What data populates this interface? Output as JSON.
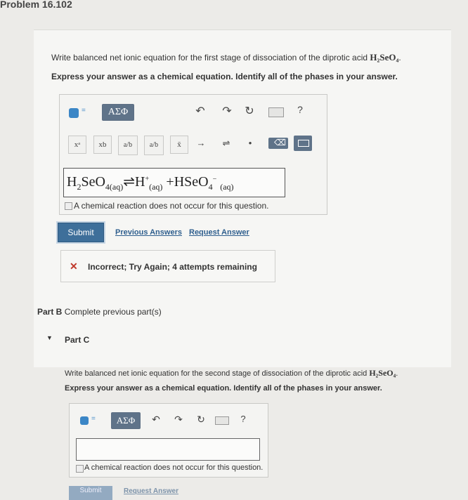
{
  "problem_title": "Problem 16.102",
  "partA": {
    "question_prefix": "Write balanced net ionic equation for the first stage of dissociation of the diprotic acid ",
    "acid_formula": "H₂SeO₄",
    "question_suffix": ".",
    "instruction": "Express your answer as a chemical equation. Identify all of the phases in your answer.",
    "toolbar": {
      "greek_label": "ΑΣΦ",
      "help_label": "?",
      "buttons": [
        "xᵃ",
        "xb",
        "a/b",
        "a/b",
        "x̄",
        "→",
        "⇌",
        "•"
      ]
    },
    "answer": {
      "reactant": "H",
      "reactant_sub1": "2",
      "reactant_mid": "SeO",
      "reactant_sub2": "4(aq)",
      "arrow": "⇌",
      "product1": "H",
      "product1_sup": "+",
      "product1_phase": "(aq)",
      "plus": "+",
      "product2": "HSeO",
      "product2_sub": "4",
      "product2_sup": "−",
      "product2_phase": "(aq)"
    },
    "no_reaction_label": "A chemical reaction does not occur for this question.",
    "submit_label": "Submit",
    "previous_answers_label": "Previous Answers",
    "request_answer_label": "Request Answer",
    "feedback": "Incorrect; Try Again; 4 attempts remaining"
  },
  "partB": {
    "label": "Part B",
    "status": "Complete previous part(s)"
  },
  "partC": {
    "label": "Part C",
    "question_prefix": "Write balanced net ionic equation for the second stage of dissociation of the diprotic acid ",
    "acid_formula": "H₂SeO₄",
    "question_suffix": ".",
    "instruction": "Express your answer as a chemical equation. Identify all of the phases in your answer.",
    "greek_label": "ΑΣΦ",
    "help_label": "?",
    "answer_value": "",
    "no_reaction_label": "A chemical reaction does not occur for this question.",
    "submit_label": "Submit",
    "request_answer_label": "Request Answer"
  }
}
